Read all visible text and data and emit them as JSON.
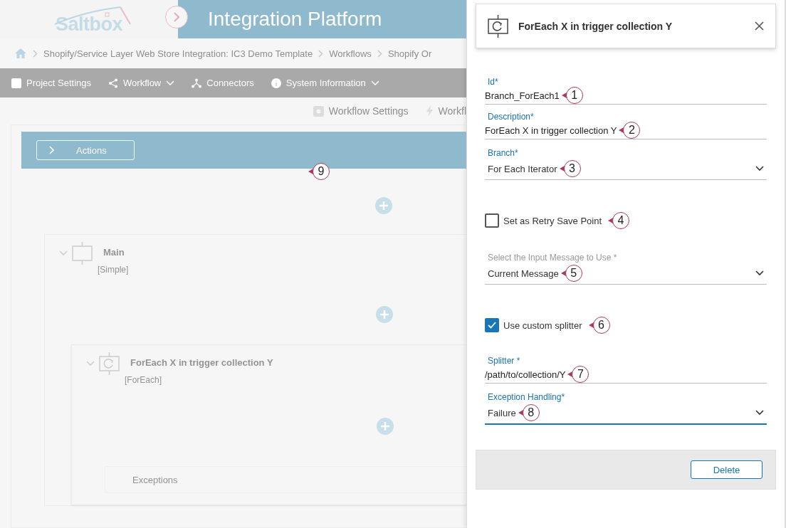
{
  "header": {
    "logo": "Saltbox",
    "title": "Integration Platform"
  },
  "breadcrumb": [
    "Shopify/Service Layer Web Store Integration: IC3 Demo Template",
    "Workflows",
    "Shopify Or"
  ],
  "menu": [
    {
      "label": "Project Settings",
      "dropdown": false
    },
    {
      "label": "Workflow",
      "dropdown": true
    },
    {
      "label": "Connectors",
      "dropdown": false
    },
    {
      "label": "System Information",
      "dropdown": true
    }
  ],
  "toolbar": [
    "Workflow Settings",
    "Workfl"
  ],
  "actions_bar": {
    "label": "Actions",
    "callout": "9"
  },
  "steps": [
    {
      "title": "Main",
      "type": "[Simple]",
      "expanded": true,
      "children": [
        {
          "title": "ForEach X in trigger collection Y",
          "type": "[ForEach]",
          "expanded": true,
          "section": "Exceptions"
        }
      ]
    }
  ],
  "panel": {
    "title": "ForEach X in trigger collection Y",
    "fields": [
      {
        "kind": "text",
        "label": "Id*",
        "label_active": true,
        "value": "Branch_ForEach1",
        "focused": false,
        "callout": "1"
      },
      {
        "kind": "text",
        "label": "Description*",
        "label_active": true,
        "value": "ForEach X in trigger collection Y",
        "focused": false,
        "callout": "2"
      },
      {
        "kind": "select",
        "label": "Branch*",
        "label_active": true,
        "value": "For Each Iterator",
        "focused": false,
        "callout": "3"
      },
      {
        "kind": "checkbox",
        "label": "Set as Retry Save Point",
        "checked": false,
        "callout": "4"
      },
      {
        "kind": "select",
        "label": "Select the Input Message to Use *",
        "label_active": false,
        "value": "Current Message",
        "focused": false,
        "callout": "5"
      },
      {
        "kind": "checkbox",
        "label": "Use custom splitter",
        "checked": true,
        "callout": "6"
      },
      {
        "kind": "text",
        "label": "Splitter *",
        "label_active": true,
        "value": "/path/to/collection/Y",
        "focused": false,
        "callout": "7"
      },
      {
        "kind": "select",
        "label": "Exception Handling*",
        "label_active": true,
        "value": "Failure",
        "focused": true,
        "callout": "8"
      }
    ],
    "buttons": [
      "Delete"
    ]
  }
}
